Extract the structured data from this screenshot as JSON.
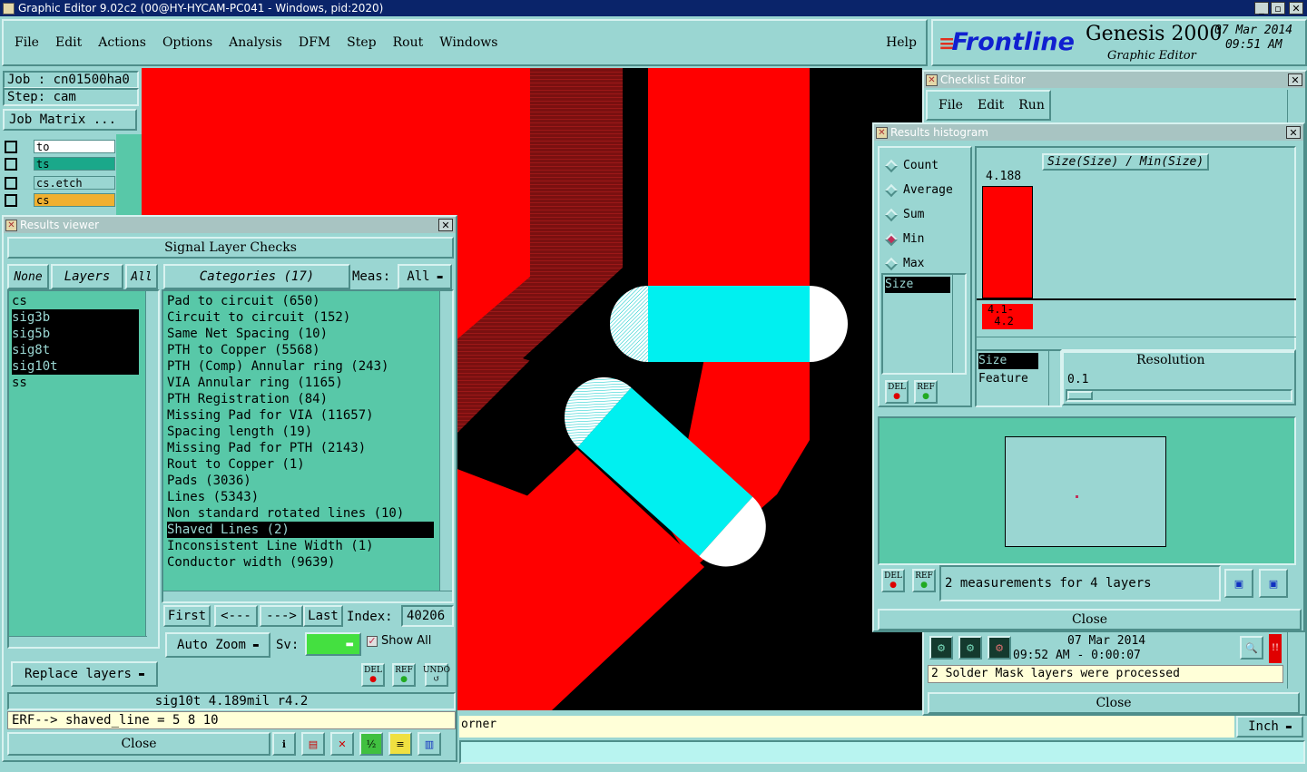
{
  "window": {
    "title": "Graphic Editor 9.02c2 (00@HY-HYCAM-PC041 - Windows, pid:2020)",
    "controls": [
      "_",
      "▫",
      "✕"
    ]
  },
  "menubar": [
    "File",
    "Edit",
    "Actions",
    "Options",
    "Analysis",
    "DFM",
    "Step",
    "Rout",
    "Windows"
  ],
  "help_label": "Help",
  "brand": {
    "logo": "Frontline",
    "product": "Genesis 2000",
    "subtitle": "Graphic Editor",
    "date": "07 Mar 2014",
    "time": "09:51 AM"
  },
  "job": {
    "job": "Job : cn01500ha0",
    "step": "Step: cam",
    "matrix_button": "Job Matrix ..."
  },
  "layer_list": [
    {
      "name": "to",
      "color": "#ffffff"
    },
    {
      "name": "ts",
      "color": "#1aa88a"
    },
    {
      "name": "cs.etch",
      "color": "#9ad6d2"
    },
    {
      "name": "cs",
      "color": "#f0b030"
    }
  ],
  "results_viewer": {
    "title": "Results viewer",
    "header": "Signal Layer Checks",
    "none_btn": "None",
    "layers_btn": "Layers",
    "all_btn": "All",
    "categories_btn": "Categories (17)",
    "meas_label": "Meas:",
    "meas_value": "All",
    "layers": [
      "cs",
      "sig3b",
      "sig5b",
      "sig8t",
      "sig10t",
      "ss"
    ],
    "selected_layers": [
      1,
      2,
      3,
      4
    ],
    "categories": [
      "Pad to circuit (650)",
      "Circuit to circuit (152)",
      "Same Net Spacing (10)",
      "PTH to Copper (5568)",
      "PTH (Comp) Annular ring (243)",
      "VIA Annular ring (1165)",
      "PTH Registration (84)",
      "Missing Pad for VIA (11657)",
      "Spacing length (19)",
      "Missing Pad for PTH (2143)",
      "Rout to Copper (1)",
      "Pads (3036)",
      "Lines (5343)",
      "Non standard rotated lines (10)",
      "Shaved Lines (2)",
      "Inconsistent Line Width (1)",
      "Conductor width (9639)"
    ],
    "selected_category": 14,
    "first_btn": "First",
    "prev_btn": "<---",
    "next_btn": "--->",
    "last_btn": "Last",
    "index_label": "Index:",
    "index_value": "40206",
    "autozoom_btn": "Auto Zoom",
    "sv_label": "Sv:",
    "show_all_label": "Show All",
    "replace_btn": "Replace layers",
    "del_label": "DEL",
    "ref_label": "REF",
    "undo_label": "UNDO",
    "status": "sig10t 4.189mil  r4.2",
    "erf": "ERF--> shaved_line = 5 8 10",
    "close_btn": "Close"
  },
  "checklist_editor": {
    "title": "Checklist Editor",
    "menu": [
      "File",
      "Edit",
      "Run"
    ],
    "date": "07 Mar 2014",
    "time": "09:52 AM - 0:00:07",
    "message": "2 Solder Mask layers were processed",
    "close_btn": "Close"
  },
  "histogram": {
    "title": "Results histogram",
    "options": [
      "Count",
      "Average",
      "Sum",
      "Min",
      "Max"
    ],
    "selected_option": "Min",
    "formula": "Size(Size) / Min(Size)",
    "bar_value": "4.188",
    "bar_range": "4.1-\n 4.2",
    "attr_list": [
      "Size"
    ],
    "size_list": [
      "Size",
      "Feature"
    ],
    "resolution_label": "Resolution",
    "resolution_value": "0.1",
    "measurement_text": "2 measurements for 4 layers",
    "close_btn": "Close",
    "del_label": "DEL",
    "ref_label": "REF"
  },
  "bottom": {
    "status_text": "orner",
    "unit": "Inch"
  },
  "colors": {
    "panel": "#9ad6d2",
    "dark": "#4e8e8a",
    "copper": "#ff0000",
    "highlight": "#00f0f0",
    "list_bg": "#58c8a8"
  }
}
